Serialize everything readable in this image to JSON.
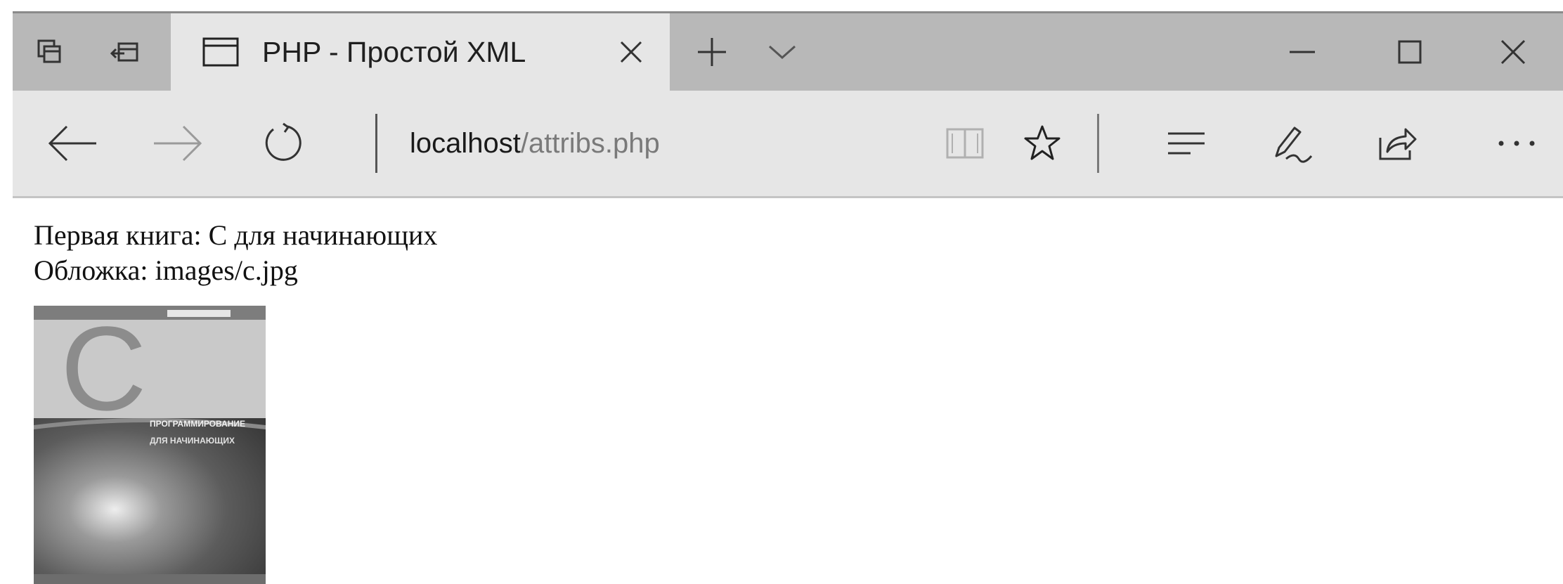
{
  "browser": {
    "tab": {
      "title": "PHP - Простой XML"
    },
    "address": {
      "host": "localhost",
      "path": "/attribs.php"
    },
    "icons": {
      "tab_list": "tab-list-icon",
      "set_aside": "set-tabs-aside-icon",
      "tab_page": "tab-page-icon",
      "tab_close": "close-icon",
      "new_tab": "plus-icon",
      "tab_preview": "chevron-down-icon",
      "minimize": "minimize-icon",
      "maximize": "maximize-icon",
      "close_window": "close-icon",
      "back": "back-arrow-icon",
      "forward": "forward-arrow-icon",
      "refresh": "refresh-icon",
      "reading_view": "book-icon",
      "favorite": "star-icon",
      "hub": "hub-icon",
      "notes": "pen-icon",
      "share": "share-icon",
      "more": "more-icon"
    }
  },
  "page": {
    "book_line": "Первая книга: C для начинающих",
    "cover_line": "Обложка: images/c.jpg",
    "cover_image": {
      "letter": "C",
      "subtitle_1": "ПРОГРАММИРОВАНИЕ",
      "subtitle_2": "ДЛЯ НАЧИНАЮЩИХ"
    }
  }
}
